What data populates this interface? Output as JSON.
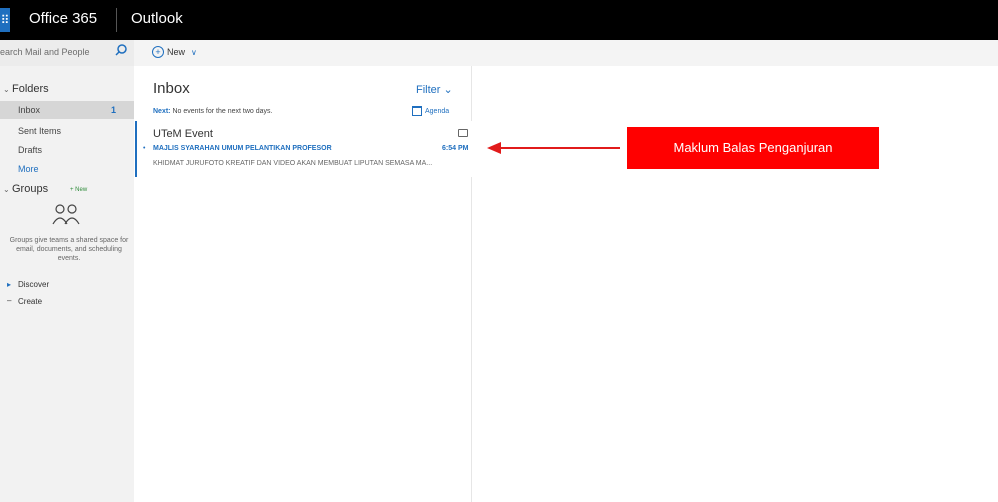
{
  "header": {
    "waffle": "⠿",
    "brand": "Office 365",
    "app": "Outlook"
  },
  "search": {
    "placeholder": "earch Mail and People"
  },
  "commands": {
    "new_label": "New",
    "new_chevron": "∨"
  },
  "nav": {
    "folders_label": "Folders",
    "items": [
      {
        "label": "Inbox",
        "count": "1"
      },
      {
        "label": "Sent Items"
      },
      {
        "label": "Drafts"
      },
      {
        "label": "More"
      }
    ],
    "groups_label": "Groups",
    "groups_new": "+ New",
    "groups_desc": "Groups give teams a shared space for email, documents, and scheduling events.",
    "discover": "Discover",
    "create": "Create"
  },
  "inbox": {
    "title": "Inbox",
    "filter": "Filter",
    "next_label": "Next:",
    "next_text": "No events for the next two days.",
    "agenda": "Agenda",
    "message": {
      "sender": "UTeM Event",
      "subject": "MAJLIS SYARAHAN UMUM PELANTIKAN PROFESOR",
      "time": "6:54 PM",
      "preview": "KHIDMAT JURUFOTO KREATIF DAN VIDEO AKAN MEMBUAT LIPUTAN SEMASA MA..."
    }
  },
  "annotation": {
    "callout": "Maklum Balas Penganjuran",
    "color": "#ff0000"
  }
}
